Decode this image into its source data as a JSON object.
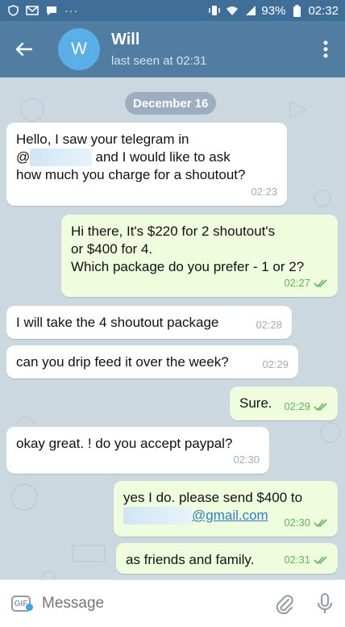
{
  "status_bar": {
    "battery": "93%",
    "time": "02:32",
    "dots": "···"
  },
  "header": {
    "avatar_letter": "W",
    "title": "Will",
    "subtitle": "last seen at 02:31"
  },
  "chat": {
    "date": "December 16",
    "messages": [
      {
        "dir": "in",
        "lines": [
          "Hello, I saw your telegram in",
          "@ [redacted] and I would like to ask",
          "how much you charge for a shoutout?"
        ],
        "time": "02:23"
      },
      {
        "dir": "out",
        "lines": [
          "Hi there, It's $220 for 2 shoutout's",
          "or $400 for 4.",
          "Which package do you prefer - 1 or 2?"
        ],
        "time": "02:27"
      },
      {
        "dir": "in",
        "lines": [
          "I will take the 4 shoutout package"
        ],
        "time": "02:28"
      },
      {
        "dir": "in",
        "lines": [
          "can you drip feed it over the week?"
        ],
        "time": "02:29"
      },
      {
        "dir": "out",
        "lines": [
          "Sure."
        ],
        "time": "02:29"
      },
      {
        "dir": "in",
        "lines": [
          "okay great. ! do you accept paypal?"
        ],
        "time": "02:30"
      },
      {
        "dir": "out",
        "lines": [
          "yes I do. please send $400 to",
          "@gmail.com"
        ],
        "time": "02:30"
      },
      {
        "dir": "out",
        "lines": [
          "as friends and family."
        ],
        "time": "02:31"
      }
    ]
  },
  "input": {
    "placeholder": "Message",
    "gif_label": "GIF"
  },
  "colors": {
    "header": "#517da2",
    "status_bar": "#3f6f99",
    "incoming": "#ffffff",
    "outgoing": "#effdde",
    "read_ticks": "#5fb45a"
  }
}
